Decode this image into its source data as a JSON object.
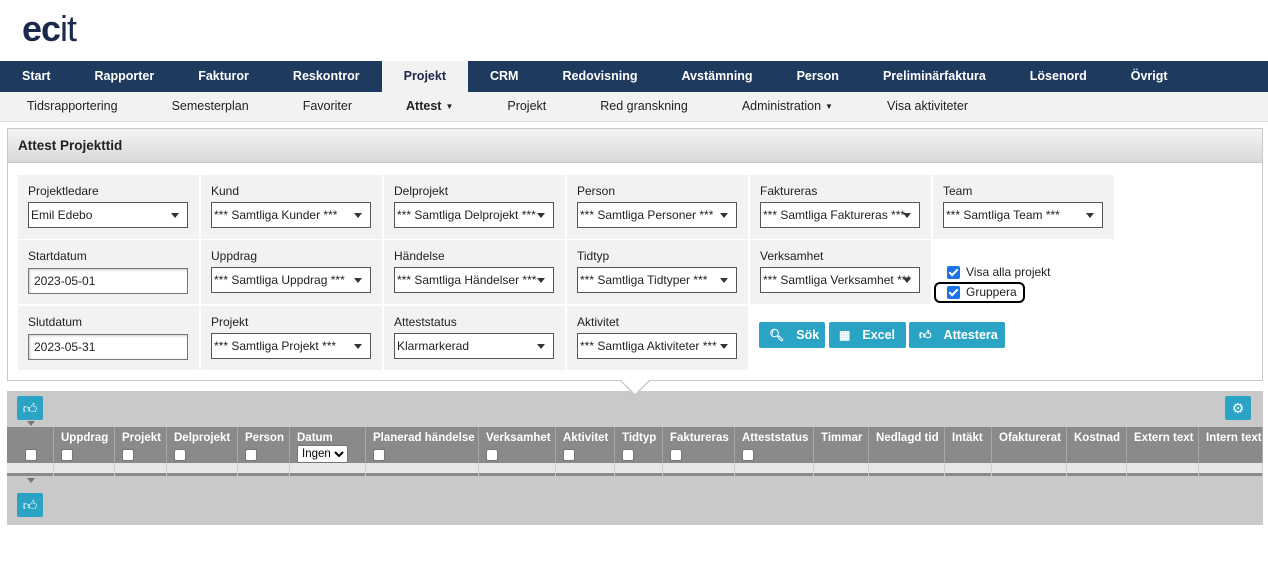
{
  "logo": {
    "ec": "ec",
    "it": "it"
  },
  "main_nav": [
    "Start",
    "Rapporter",
    "Fakturor",
    "Reskontror",
    "Projekt",
    "CRM",
    "Redovisning",
    "Avstämning",
    "Person",
    "Preliminärfaktura",
    "Lösenord",
    "Övrigt"
  ],
  "main_nav_active": "Projekt",
  "sub_nav": [
    "Tidsrapportering",
    "Semesterplan",
    "Favoriter",
    "Attest",
    "Projekt",
    "Red granskning",
    "Administration",
    "Visa aktiviteter"
  ],
  "sub_nav_active": "Attest",
  "panel": {
    "title": "Attest Projekttid",
    "fields": {
      "projektledare": {
        "label": "Projektledare",
        "value": "Emil Edebo"
      },
      "kund": {
        "label": "Kund",
        "value": "*** Samtliga Kunder ***"
      },
      "delprojekt": {
        "label": "Delprojekt",
        "value": "*** Samtliga Delprojekt ***"
      },
      "person": {
        "label": "Person",
        "value": "*** Samtliga Personer ***"
      },
      "faktureras": {
        "label": "Faktureras",
        "value": "*** Samtliga Faktureras ***"
      },
      "team": {
        "label": "Team",
        "value": "*** Samtliga Team ***"
      },
      "startdatum": {
        "label": "Startdatum",
        "value": "2023-05-01"
      },
      "uppdrag": {
        "label": "Uppdrag",
        "value": "*** Samtliga Uppdrag ***"
      },
      "handelse": {
        "label": "Händelse",
        "value": "*** Samtliga Händelser ***"
      },
      "tidtyp": {
        "label": "Tidtyp",
        "value": "*** Samtliga Tidtyper ***"
      },
      "verksamhet": {
        "label": "Verksamhet",
        "value": "*** Samtliga Verksamhet ***"
      },
      "slutdatum": {
        "label": "Slutdatum",
        "value": "2023-05-31"
      },
      "projekt": {
        "label": "Projekt",
        "value": "*** Samtliga Projekt ***"
      },
      "atteststatus": {
        "label": "Atteststatus",
        "value": "Klarmarkerad"
      },
      "aktivitet": {
        "label": "Aktivitet",
        "value": "*** Samtliga Aktiviteter ***"
      }
    },
    "checkboxes": {
      "visa_alla": "Visa alla projekt",
      "gruppera": "Gruppera"
    },
    "buttons": {
      "sok": "Sök",
      "excel": "Excel",
      "attestera": "Attestera"
    }
  },
  "grid": {
    "columns": [
      "",
      "Uppdrag",
      "Projekt",
      "Delprojekt",
      "Person",
      "Datum",
      "Planerad händelse",
      "Verksamhet",
      "Aktivitet",
      "Tidtyp",
      "Faktureras",
      "Atteststatus",
      "Timmar",
      "Nedlagd tid",
      "Intäkt",
      "Ofakturerat",
      "Kostnad",
      "Extern text",
      "Intern text"
    ],
    "datum_select": "Ingen"
  },
  "icons": {
    "search": "search-icon",
    "excel": "excel-icon",
    "thumbs": "thumbs-up-icon",
    "settings": "gears-icon"
  }
}
